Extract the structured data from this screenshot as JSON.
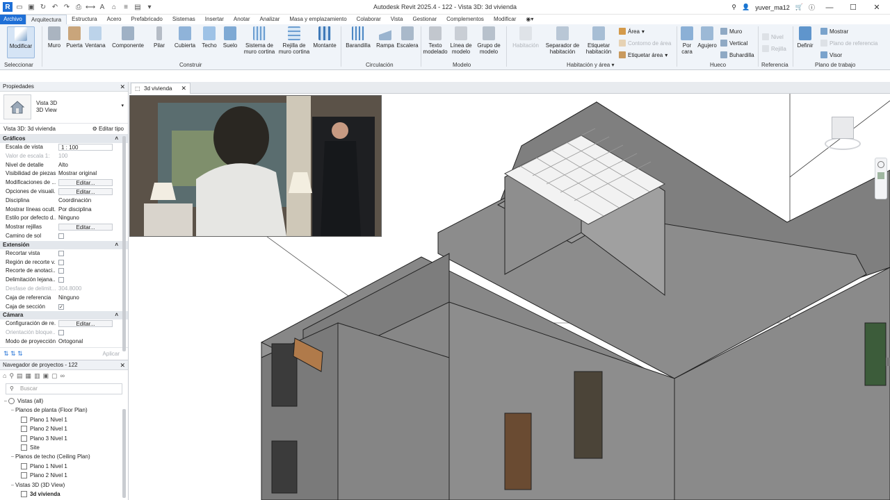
{
  "app": {
    "title": "Autodesk Revit 2025.4 - 122 - Vista 3D: 3d vivienda",
    "user": "yuver_ma12"
  },
  "tabs": [
    "Archivo",
    "Arquitectura",
    "Estructura",
    "Acero",
    "Prefabricado",
    "Sistemas",
    "Insertar",
    "Anotar",
    "Analizar",
    "Masa y emplazamiento",
    "Colaborar",
    "Vista",
    "Gestionar",
    "Complementos",
    "Modificar"
  ],
  "ribbon": {
    "modify": "Modificar",
    "select": "Seleccionar",
    "build": [
      "Muro",
      "Puerta",
      "Ventana",
      "Componente",
      "Pilar",
      "Cubierta",
      "Techo",
      "Suelo",
      "Sistema de muro cortina",
      "Rejilla de muro cortina",
      "Montante"
    ],
    "build_label": "Construir",
    "circ": [
      "Barandilla",
      "Rampa",
      "Escalera"
    ],
    "circ_label": "Circulación",
    "model": [
      "Texto modelado",
      "Línea de modelo",
      "Grupo de modelo"
    ],
    "model_label": "Modelo",
    "room": [
      "Habitación",
      "Separador de habitación",
      "Etiquetar habitación"
    ],
    "area": [
      "Área",
      "Contorno de área",
      "Etiquetar área"
    ],
    "room_label": "Habitación y área",
    "opening": [
      "Por cara",
      "Agujero",
      "Muro",
      "Vertical",
      "Buhardilla"
    ],
    "opening_label": "Hueco",
    "datum": [
      "Nivel",
      "Rejilla"
    ],
    "datum_label": "Referencia",
    "work": [
      "Definir",
      "Mostrar",
      "Plano de referencia",
      "Visor"
    ],
    "work_label": "Plano de trabajo"
  },
  "properties": {
    "title": "Propiedades",
    "type1": "Vista 3D",
    "type2": "3D View",
    "instance": "Vista 3D: 3d vivienda",
    "edit_type": "Editar tipo",
    "sections": [
      "Gráficos",
      "Extensión",
      "Cámara"
    ],
    "graphics": [
      [
        "Escala de vista",
        "1 : 100"
      ],
      [
        "Valor de escala    1:",
        "100"
      ],
      [
        "Nivel de detalle",
        "Alto"
      ],
      [
        "Visibilidad de piezas",
        "Mostrar original"
      ],
      [
        "Modificaciones de ...",
        "Editar..."
      ],
      [
        "Opciones de visuali...",
        "Editar..."
      ],
      [
        "Disciplina",
        "Coordinación"
      ],
      [
        "Mostrar líneas ocult...",
        "Por disciplina"
      ],
      [
        "Estilo por defecto d...",
        "Ninguno"
      ],
      [
        "Mostrar rejillas",
        "Editar..."
      ],
      [
        "Camino de sol",
        ""
      ]
    ],
    "extents": [
      [
        "Recortar vista",
        ""
      ],
      [
        "Región de recorte v...",
        ""
      ],
      [
        "Recorte de anotaci...",
        ""
      ],
      [
        "Delimitación lejana...",
        ""
      ],
      [
        "Desfase de delimit...",
        "304.8000"
      ],
      [
        "Caja de referencia",
        "Ninguno"
      ],
      [
        "Caja de sección",
        ""
      ]
    ],
    "camera": [
      [
        "Configuración de re...",
        "Editar..."
      ],
      [
        "Orientación bloque...",
        ""
      ],
      [
        "Modo de proyección",
        "Ortogonal"
      ]
    ],
    "apply": "Aplicar"
  },
  "browser": {
    "title": "Navegador de proyectos - 122",
    "search": "Buscar",
    "nodes": [
      [
        "0",
        "Vistas (all)"
      ],
      [
        "1",
        "Planos de planta (Floor Plan)"
      ],
      [
        "2",
        "Plano 1 Nivel 1"
      ],
      [
        "2",
        "Plano 2 Nivel 1"
      ],
      [
        "2",
        "Plano 3 Nivel 1"
      ],
      [
        "2",
        "Site"
      ],
      [
        "1",
        "Planos de techo (Ceiling Plan)"
      ],
      [
        "2",
        "Plano 1 Nivel 1"
      ],
      [
        "2",
        "Plano 2 Nivel 1"
      ],
      [
        "1",
        "Vistas 3D (3D View)"
      ],
      [
        "2",
        "3d vivienda"
      ]
    ]
  },
  "view": {
    "tab": "3d vivienda"
  },
  "colors": {
    "accent": "#1e6fd6",
    "ribbon": "#f0f4f9",
    "wall": "#7e7e7e"
  }
}
